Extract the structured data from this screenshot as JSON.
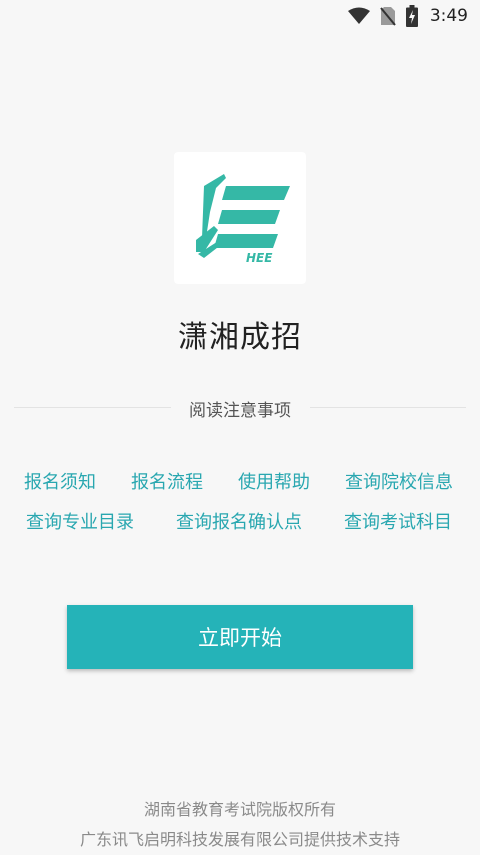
{
  "status_bar": {
    "time": "3:49",
    "icons": [
      "wifi-icon",
      "no-sim-icon",
      "battery-charging-icon"
    ]
  },
  "logo": {
    "caption": "HEE"
  },
  "app": {
    "title": "潇湘成招"
  },
  "notice": {
    "label": "阅读注意事项"
  },
  "links": {
    "row1": [
      "报名须知",
      "报名流程",
      "使用帮助",
      "查询院校信息"
    ],
    "row2": [
      "查询专业目录",
      "查询报名确认点",
      "查询考试科目"
    ]
  },
  "start_button": {
    "label": "立即开始"
  },
  "footer": {
    "line1": "湖南省教育考试院版权所有",
    "line2": "广东讯飞启明科技发展有限公司提供技术支持"
  },
  "colors": {
    "accent": "#25b3b8",
    "link": "#29a7b0",
    "logo": "#35b8a6"
  }
}
